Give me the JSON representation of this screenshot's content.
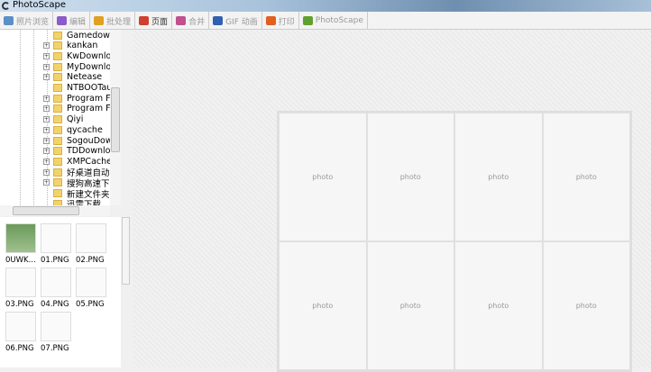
{
  "window": {
    "title": "PhotoScape"
  },
  "tabs": [
    {
      "label": "照片浏览",
      "color": "#5b8fc9"
    },
    {
      "label": "编辑",
      "color": "#8a5bc9"
    },
    {
      "label": "批处理",
      "color": "#e0a020"
    },
    {
      "label": "页面",
      "color": "#d04030"
    },
    {
      "label": "合并",
      "color": "#c05090"
    },
    {
      "label": "GIF 动画",
      "color": "#3060b0"
    },
    {
      "label": "打印",
      "color": "#e06020"
    },
    {
      "label": "PhotoScape",
      "color": "#60a030"
    }
  ],
  "active_tab": "页面",
  "tree": [
    {
      "label": "Gamedownl",
      "expandable": false
    },
    {
      "label": "kankan",
      "expandable": true
    },
    {
      "label": "KwDownloa",
      "expandable": true
    },
    {
      "label": "MyDownloa",
      "expandable": true
    },
    {
      "label": "Netease",
      "expandable": true
    },
    {
      "label": "NTBOOTaut",
      "expandable": false
    },
    {
      "label": "Program File",
      "expandable": true
    },
    {
      "label": "Program File",
      "expandable": true
    },
    {
      "label": "Qiyi",
      "expandable": true
    },
    {
      "label": "qycache",
      "expandable": true
    },
    {
      "label": "SogouDown",
      "expandable": true
    },
    {
      "label": "TDDownloa",
      "expandable": true
    },
    {
      "label": "XMPCache",
      "expandable": true
    },
    {
      "label": "好桌道自动",
      "expandable": true
    },
    {
      "label": "搜狗高速下载",
      "expandable": true
    },
    {
      "label": "新建文件夹",
      "expandable": false
    },
    {
      "label": "迅雷下载",
      "expandable": false
    }
  ],
  "thumbnails": [
    "0UWK...",
    "01.PNG",
    "02.PNG",
    "03.PNG",
    "04.PNG",
    "05.PNG",
    "06.PNG",
    "07.PNG"
  ],
  "page": {
    "cells": [
      "photo",
      "photo",
      "photo",
      "photo",
      "photo",
      "photo",
      "photo",
      "photo"
    ]
  }
}
